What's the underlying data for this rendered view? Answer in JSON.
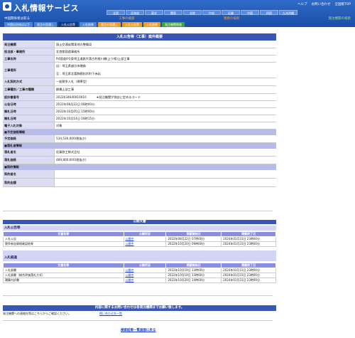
{
  "header": {
    "title": "入札情報サービス",
    "links": [
      "ヘルプ",
      "お問い合わせ",
      "全国版TOP"
    ],
    "regions": [
      "全国",
      "北海道",
      "東北",
      "関東",
      "北陸",
      "中部",
      "近畿",
      "中国",
      "四国",
      "九州沖縄"
    ],
    "categories": [
      "中国関係者は取る",
      "工事の検索",
      "業務の検索",
      "発注機関の検索"
    ],
    "tabs": [
      "中国自治体は以下",
      "発注の見通し",
      "入札公告等",
      "入札結果",
      "発注の見通し",
      "入札公告等",
      "入札結果",
      "発注機関情報"
    ]
  },
  "detail": {
    "bar_title": "入札公告等（工事）案件概要",
    "rows": [
      {
        "label": "発注機関",
        "value": "国土交通省関東地方整備局"
      },
      {
        "label": "担当部・事務所",
        "value": "北首都国道事務所"
      },
      {
        "label": "工事名称",
        "value": "R4国道4号東埼玉道路大落古利根川橋(上り線)上部工事"
      },
      {
        "label": "工事場所",
        "value": "自：埼玉県越谷市増森",
        "value2": "至：埼玉県北葛飾郡松伏町下赤岩"
      },
      {
        "label": "入札契約方式",
        "value": "一般競争入札（標準型）"
      },
      {
        "label": "工事種別／工事の種類",
        "value": "鋼橋上部工事"
      },
      {
        "label": "設計書番号",
        "value": "2022034640010010",
        "note": "★発注機関が独自に定めるコード"
      },
      {
        "label": "公告日時",
        "value": "2022年08月22日 00時00分"
      },
      {
        "label": "開札日時",
        "value": "2022年10月05日 15時00分"
      },
      {
        "label": "開札日時",
        "value": "2022年10月14日 16時15分"
      },
      {
        "label": "電子入札対象",
        "value": "対象"
      }
    ],
    "estimate_section": "■予定価格情報",
    "estimate_label": "予定価格",
    "estimate_value": "534,530,000(税抜き)",
    "winner_section": "■落札者情報",
    "winner_name_label": "落札者名",
    "winner_name": "佐藤鉄工株式会社",
    "winner_price_label": "落札価格",
    "winner_price": "489,800,000(税抜き)",
    "contract_section": "■契約情報",
    "contractor_label": "契約者名",
    "contract_amount_label": "契約金額"
  },
  "docs": {
    "title": "公開文書",
    "group1": "入札公告等",
    "group2": "入札経過",
    "headers": [
      "文書名称",
      "公開状況",
      "掲載開始日",
      "掲載終了日"
    ],
    "rows1": [
      [
        "入札公告",
        "公開中",
        "2022年08月22日 07時00分",
        "2024年01月31日 23時00分"
      ],
      [
        "競争参加資格確認結果",
        "公開中",
        "2022年10月20日 09時00分",
        "2024年01月31日 23時00分"
      ]
    ],
    "rows2": [
      [
        "入札調書",
        "公開中",
        "2022年10月19日 13時00分",
        "2024年01月31日 23時00分"
      ],
      [
        "入札調書（総合評価落札方式）",
        "公開中",
        "2022年10月19日 13時00分",
        "2024年01月31日 23時00分"
      ],
      [
        "積算内訳書",
        "公開中",
        "2022年10月20日 14時00分",
        "2024年01月31日 23時00分"
      ]
    ]
  },
  "footer": {
    "notice": "内容に関するお問い合わせは各発注機関までお願い致します。",
    "contact_text": "発注機関への連絡先等はこちらからご確認ください。",
    "contact_link": "問い合わせ先一覧",
    "back_link": "検索結果一覧画面に戻る"
  }
}
